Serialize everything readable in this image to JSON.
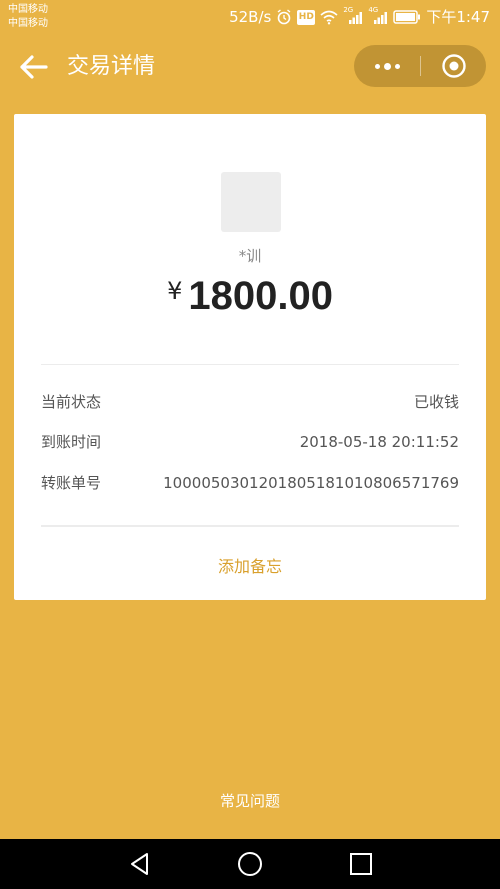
{
  "status_bar": {
    "carrier_1": "中国移动",
    "carrier_2": "中国移动",
    "net_speed": "52B/s",
    "hd_badge": "HD",
    "sig1_label": "2G",
    "sig2_label": "4G",
    "time": "下午1:47"
  },
  "nav": {
    "title": "交易详情",
    "back_icon": "arrow-left-icon",
    "more_icon": "more-dots-icon",
    "close_icon": "target-close-icon"
  },
  "transaction": {
    "payee": "*训",
    "currency": "¥",
    "amount": "1800.00",
    "rows": [
      {
        "label": "当前状态",
        "value": "已收钱"
      },
      {
        "label": "到账时间",
        "value": "2018-05-18 20:11:52"
      },
      {
        "label": "转账单号",
        "value": "1000050301201805181010806571769"
      }
    ],
    "memo_link": "添加备忘"
  },
  "footer": {
    "faq_link": "常见问题"
  },
  "system_nav": {
    "back_icon": "triangle-back-icon",
    "home_icon": "circle-home-icon",
    "recents_icon": "square-recents-icon"
  },
  "colors": {
    "background": "#e8b445",
    "card": "#ffffff",
    "link": "#d9a02c"
  }
}
